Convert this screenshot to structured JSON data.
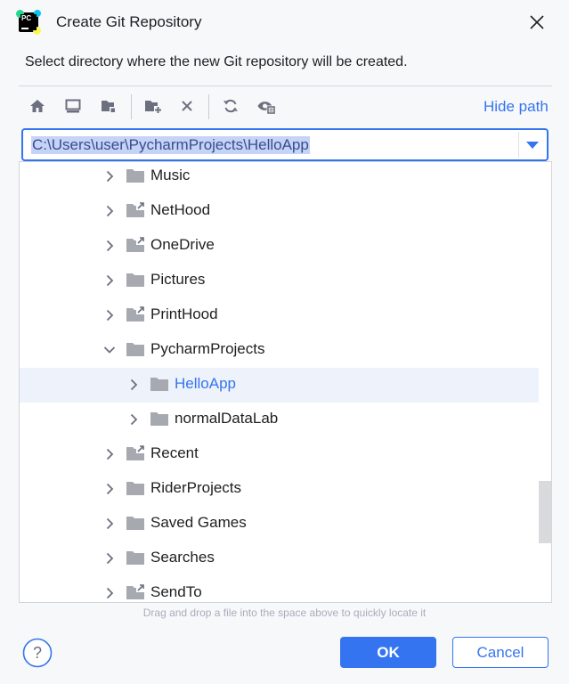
{
  "dialog": {
    "title": "Create Git Repository",
    "app_icon": "pycharm-logo",
    "app_icon_text": "PC",
    "close_icon": "close-icon",
    "instruction": "Select directory where the new Git repository will be created."
  },
  "toolbar": {
    "buttons": [
      {
        "name": "home-icon",
        "interactable": true
      },
      {
        "name": "desktop-icon",
        "interactable": true
      },
      {
        "name": "project-folder-icon",
        "interactable": true
      },
      {
        "name": "new-folder-icon",
        "interactable": true
      },
      {
        "name": "delete-icon",
        "interactable": true
      },
      {
        "name": "refresh-icon",
        "interactable": true
      },
      {
        "name": "show-hidden-icon",
        "interactable": true
      }
    ],
    "hide_path_label": "Hide path"
  },
  "path": {
    "value": "C:\\Users\\user\\PycharmProjects\\HelloApp",
    "dropdown_icon": "chevron-down-icon"
  },
  "tree": {
    "rows": [
      {
        "label": "Music",
        "depth": 0,
        "expanded": false,
        "link": false,
        "selected": false
      },
      {
        "label": "NetHood",
        "depth": 0,
        "expanded": false,
        "link": true,
        "selected": false
      },
      {
        "label": "OneDrive",
        "depth": 0,
        "expanded": false,
        "link": true,
        "selected": false
      },
      {
        "label": "Pictures",
        "depth": 0,
        "expanded": false,
        "link": false,
        "selected": false
      },
      {
        "label": "PrintHood",
        "depth": 0,
        "expanded": false,
        "link": true,
        "selected": false
      },
      {
        "label": "PycharmProjects",
        "depth": 0,
        "expanded": true,
        "link": false,
        "selected": false
      },
      {
        "label": "HelloApp",
        "depth": 1,
        "expanded": false,
        "link": false,
        "selected": true
      },
      {
        "label": "normalDataLab",
        "depth": 1,
        "expanded": false,
        "link": false,
        "selected": false
      },
      {
        "label": "Recent",
        "depth": 0,
        "expanded": false,
        "link": true,
        "selected": false
      },
      {
        "label": "RiderProjects",
        "depth": 0,
        "expanded": false,
        "link": false,
        "selected": false
      },
      {
        "label": "Saved Games",
        "depth": 0,
        "expanded": false,
        "link": false,
        "selected": false
      },
      {
        "label": "Searches",
        "depth": 0,
        "expanded": false,
        "link": false,
        "selected": false
      },
      {
        "label": "SendTo",
        "depth": 0,
        "expanded": false,
        "link": true,
        "selected": false
      }
    ]
  },
  "hint": "Drag and drop a file into the space above to quickly locate it",
  "footer": {
    "help_icon": "help-icon",
    "ok_label": "OK",
    "cancel_label": "Cancel"
  },
  "colors": {
    "accent": "#3574f0",
    "folder": "#a6a9b0",
    "selection": "#edf2fb",
    "background": "#f7f8fa"
  }
}
